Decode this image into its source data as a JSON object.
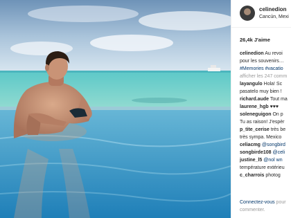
{
  "post": {
    "username": "celinedion",
    "location": "Cancún, Mexi",
    "likes": "26,4k J'aime"
  },
  "caption": {
    "user": "celinedion",
    "line1": "Au revoi",
    "line2": "pour les souvenirs…",
    "line3": "#Memories #vacatio"
  },
  "view_all": "afficher les 247 comm",
  "comments": [
    {
      "user": "layangulo",
      "text": "Hola! Sc",
      "cont": "pasatelo muy bien !"
    },
    {
      "user": "richard.aude",
      "text": "Tout ma"
    },
    {
      "user": "laurene_hgb",
      "text": "♥♥♥"
    },
    {
      "user": "soleneguigon",
      "text": "On p",
      "cont": "Tu as raison! J'espèr"
    },
    {
      "user": "p_tite_cerise",
      "text": "très be",
      "cont": "très sympa. Mexico"
    },
    {
      "user": "celiacmg",
      "text": "@songbird"
    },
    {
      "user": "songbirde108",
      "text": "@celi"
    },
    {
      "user": "justine_l5",
      "text": "@nol wn",
      "cont": "température extérieu"
    },
    {
      "user": "c_charrois",
      "text": "photog"
    }
  ],
  "footer": {
    "connect": "Connectez-vous",
    "rest": "pour",
    "line2": "commenter."
  },
  "colors": {
    "link": "#003569",
    "muted": "#999999",
    "text": "#262626"
  }
}
